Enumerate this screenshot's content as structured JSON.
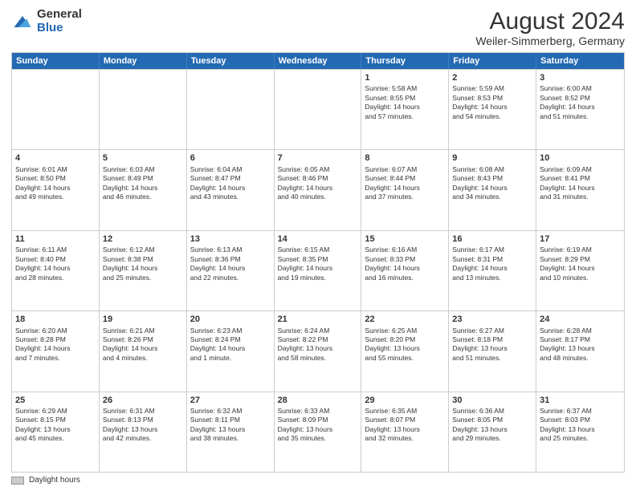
{
  "header": {
    "logo_general": "General",
    "logo_blue": "Blue",
    "month_title": "August 2024",
    "location": "Weiler-Simmerberg, Germany"
  },
  "days_of_week": [
    "Sunday",
    "Monday",
    "Tuesday",
    "Wednesday",
    "Thursday",
    "Friday",
    "Saturday"
  ],
  "weeks": [
    [
      {
        "day": "",
        "detail": ""
      },
      {
        "day": "",
        "detail": ""
      },
      {
        "day": "",
        "detail": ""
      },
      {
        "day": "",
        "detail": ""
      },
      {
        "day": "1",
        "detail": "Sunrise: 5:58 AM\nSunset: 8:55 PM\nDaylight: 14 hours\nand 57 minutes."
      },
      {
        "day": "2",
        "detail": "Sunrise: 5:59 AM\nSunset: 8:53 PM\nDaylight: 14 hours\nand 54 minutes."
      },
      {
        "day": "3",
        "detail": "Sunrise: 6:00 AM\nSunset: 8:52 PM\nDaylight: 14 hours\nand 51 minutes."
      }
    ],
    [
      {
        "day": "4",
        "detail": "Sunrise: 6:01 AM\nSunset: 8:50 PM\nDaylight: 14 hours\nand 49 minutes."
      },
      {
        "day": "5",
        "detail": "Sunrise: 6:03 AM\nSunset: 8:49 PM\nDaylight: 14 hours\nand 46 minutes."
      },
      {
        "day": "6",
        "detail": "Sunrise: 6:04 AM\nSunset: 8:47 PM\nDaylight: 14 hours\nand 43 minutes."
      },
      {
        "day": "7",
        "detail": "Sunrise: 6:05 AM\nSunset: 8:46 PM\nDaylight: 14 hours\nand 40 minutes."
      },
      {
        "day": "8",
        "detail": "Sunrise: 6:07 AM\nSunset: 8:44 PM\nDaylight: 14 hours\nand 37 minutes."
      },
      {
        "day": "9",
        "detail": "Sunrise: 6:08 AM\nSunset: 8:43 PM\nDaylight: 14 hours\nand 34 minutes."
      },
      {
        "day": "10",
        "detail": "Sunrise: 6:09 AM\nSunset: 8:41 PM\nDaylight: 14 hours\nand 31 minutes."
      }
    ],
    [
      {
        "day": "11",
        "detail": "Sunrise: 6:11 AM\nSunset: 8:40 PM\nDaylight: 14 hours\nand 28 minutes."
      },
      {
        "day": "12",
        "detail": "Sunrise: 6:12 AM\nSunset: 8:38 PM\nDaylight: 14 hours\nand 25 minutes."
      },
      {
        "day": "13",
        "detail": "Sunrise: 6:13 AM\nSunset: 8:36 PM\nDaylight: 14 hours\nand 22 minutes."
      },
      {
        "day": "14",
        "detail": "Sunrise: 6:15 AM\nSunset: 8:35 PM\nDaylight: 14 hours\nand 19 minutes."
      },
      {
        "day": "15",
        "detail": "Sunrise: 6:16 AM\nSunset: 8:33 PM\nDaylight: 14 hours\nand 16 minutes."
      },
      {
        "day": "16",
        "detail": "Sunrise: 6:17 AM\nSunset: 8:31 PM\nDaylight: 14 hours\nand 13 minutes."
      },
      {
        "day": "17",
        "detail": "Sunrise: 6:19 AM\nSunset: 8:29 PM\nDaylight: 14 hours\nand 10 minutes."
      }
    ],
    [
      {
        "day": "18",
        "detail": "Sunrise: 6:20 AM\nSunset: 8:28 PM\nDaylight: 14 hours\nand 7 minutes."
      },
      {
        "day": "19",
        "detail": "Sunrise: 6:21 AM\nSunset: 8:26 PM\nDaylight: 14 hours\nand 4 minutes."
      },
      {
        "day": "20",
        "detail": "Sunrise: 6:23 AM\nSunset: 8:24 PM\nDaylight: 14 hours\nand 1 minute."
      },
      {
        "day": "21",
        "detail": "Sunrise: 6:24 AM\nSunset: 8:22 PM\nDaylight: 13 hours\nand 58 minutes."
      },
      {
        "day": "22",
        "detail": "Sunrise: 6:25 AM\nSunset: 8:20 PM\nDaylight: 13 hours\nand 55 minutes."
      },
      {
        "day": "23",
        "detail": "Sunrise: 6:27 AM\nSunset: 8:18 PM\nDaylight: 13 hours\nand 51 minutes."
      },
      {
        "day": "24",
        "detail": "Sunrise: 6:28 AM\nSunset: 8:17 PM\nDaylight: 13 hours\nand 48 minutes."
      }
    ],
    [
      {
        "day": "25",
        "detail": "Sunrise: 6:29 AM\nSunset: 8:15 PM\nDaylight: 13 hours\nand 45 minutes."
      },
      {
        "day": "26",
        "detail": "Sunrise: 6:31 AM\nSunset: 8:13 PM\nDaylight: 13 hours\nand 42 minutes."
      },
      {
        "day": "27",
        "detail": "Sunrise: 6:32 AM\nSunset: 8:11 PM\nDaylight: 13 hours\nand 38 minutes."
      },
      {
        "day": "28",
        "detail": "Sunrise: 6:33 AM\nSunset: 8:09 PM\nDaylight: 13 hours\nand 35 minutes."
      },
      {
        "day": "29",
        "detail": "Sunrise: 6:35 AM\nSunset: 8:07 PM\nDaylight: 13 hours\nand 32 minutes."
      },
      {
        "day": "30",
        "detail": "Sunrise: 6:36 AM\nSunset: 8:05 PM\nDaylight: 13 hours\nand 29 minutes."
      },
      {
        "day": "31",
        "detail": "Sunrise: 6:37 AM\nSunset: 8:03 PM\nDaylight: 13 hours\nand 25 minutes."
      }
    ]
  ],
  "legend": {
    "label": "Daylight hours"
  }
}
